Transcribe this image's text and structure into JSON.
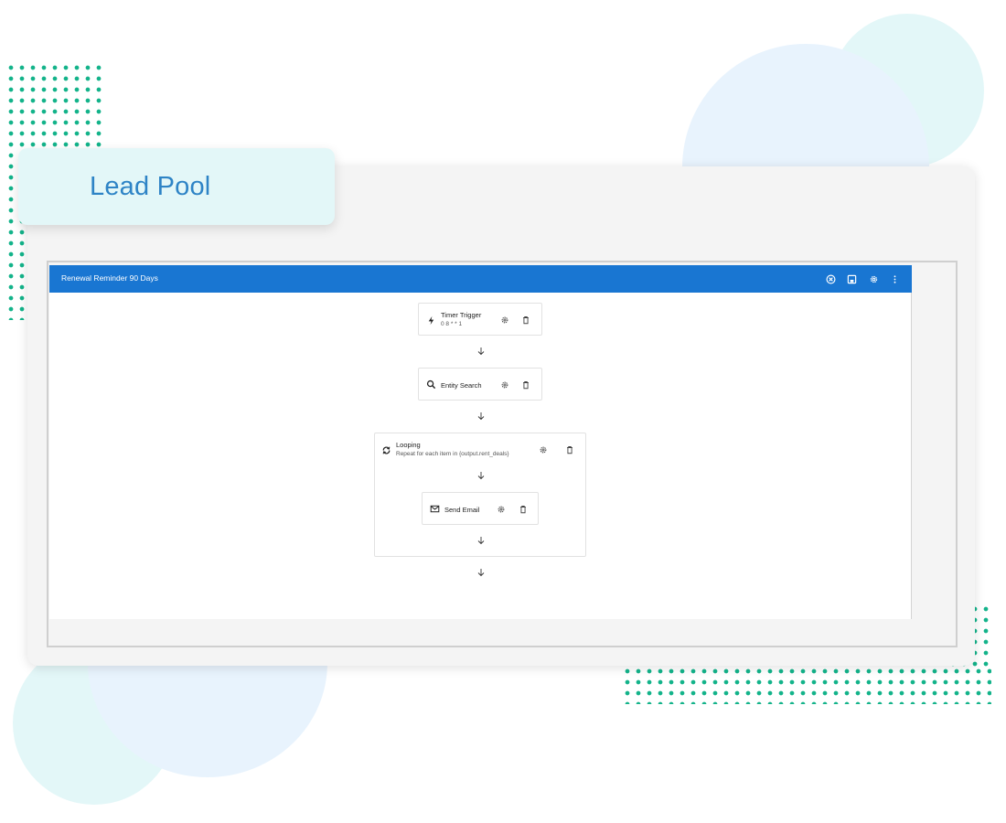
{
  "badge": {
    "title": "Lead Pool"
  },
  "workflow": {
    "title": "Renewal Reminder 90 Days",
    "header_icons": [
      "close-circle-icon",
      "save-icon",
      "gear-icon",
      "more-vertical-icon"
    ],
    "accent": "#1976d2"
  },
  "nodes": {
    "timer": {
      "title": "Timer Trigger",
      "subtitle": "0 8 * * 1",
      "icon": "lightning-icon"
    },
    "entity_search": {
      "title": "Entity Search",
      "icon": "search-icon"
    },
    "looping": {
      "title": "Looping",
      "subtitle": "Repeat for each item in {output.rent_deals}",
      "icon": "loop-icon"
    },
    "send_email": {
      "title": "Send Email",
      "icon": "mail-icon"
    }
  },
  "colors": {
    "brand_text": "#2e84c6",
    "dots": "#13b38a",
    "badge_bg": "#e3f7f8"
  }
}
